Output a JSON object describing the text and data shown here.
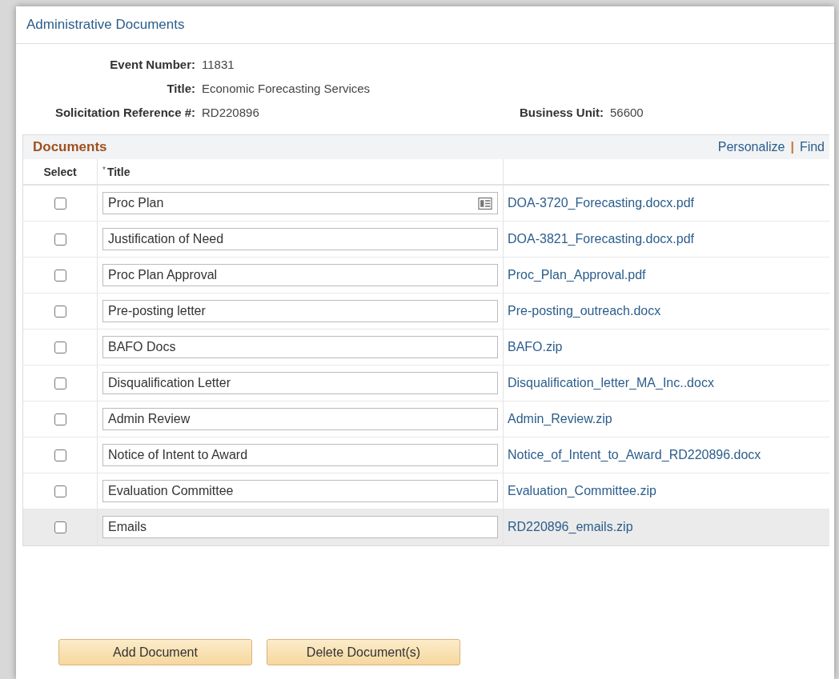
{
  "page_title": "Administrative Documents",
  "fields": [
    {
      "label": "Event Number:",
      "value": "11831"
    },
    {
      "label": "Title:",
      "value": "Economic Forecasting Services"
    },
    {
      "label": "Solicitation Reference #:",
      "value": "RD220896",
      "extra_label": "Business Unit:",
      "extra_value": "56600"
    }
  ],
  "grid": {
    "title": "Documents",
    "links": [
      "Personalize",
      "Find"
    ],
    "separator": "|",
    "columns": [
      {
        "label": "Select"
      },
      {
        "label": "Title",
        "required_mark": "*"
      }
    ],
    "rows": [
      {
        "checked": false,
        "title": "Proc Plan",
        "has_detail_icon": true,
        "file": "DOA-3720_Forecasting.docx.pdf",
        "highlighted": false
      },
      {
        "checked": false,
        "title": "Justification of Need",
        "has_detail_icon": false,
        "file": "DOA-3821_Forecasting.docx.pdf",
        "highlighted": false
      },
      {
        "checked": false,
        "title": "Proc Plan Approval",
        "has_detail_icon": false,
        "file": "Proc_Plan_Approval.pdf",
        "highlighted": false
      },
      {
        "checked": false,
        "title": "Pre-posting letter",
        "has_detail_icon": false,
        "file": "Pre-posting_outreach.docx",
        "highlighted": false
      },
      {
        "checked": false,
        "title": "BAFO Docs",
        "has_detail_icon": false,
        "file": "BAFO.zip",
        "highlighted": false
      },
      {
        "checked": false,
        "title": "Disqualification Letter",
        "has_detail_icon": false,
        "file": "Disqualification_letter_MA_Inc..docx",
        "highlighted": false
      },
      {
        "checked": false,
        "title": "Admin Review",
        "has_detail_icon": false,
        "file": "Admin_Review.zip",
        "highlighted": false
      },
      {
        "checked": false,
        "title": "Notice of Intent to Award",
        "has_detail_icon": false,
        "file": "Notice_of_Intent_to_Award_RD220896.docx",
        "highlighted": false
      },
      {
        "checked": false,
        "title": "Evaluation Committee",
        "has_detail_icon": false,
        "file": "Evaluation_Committee.zip",
        "highlighted": false
      },
      {
        "checked": false,
        "title": "Emails",
        "has_detail_icon": false,
        "file": "RD220896_emails.zip",
        "highlighted": true
      }
    ]
  },
  "buttons": [
    "Add Document",
    "Delete Document(s)"
  ]
}
